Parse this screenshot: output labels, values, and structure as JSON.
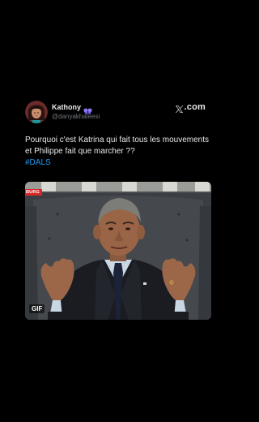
{
  "tweet": {
    "display_name": "Kathony",
    "badge_icon": "butterfly-icon",
    "handle": "@danyakhaleesi",
    "brand_text": ".com",
    "brand_icon": "x-logo-icon",
    "text_line": "Pourquoi c'est Katrina qui fait tous les mouvements et Philippe fait que marcher ??",
    "hashtag": "#DALS",
    "media": {
      "live_tag": "BURG",
      "gif_label": "GIF"
    }
  },
  "colors": {
    "background": "#000000",
    "text": "#e7e9ea",
    "secondary": "#71767b",
    "link": "#1d9bf0",
    "badge": "#8b7cf6"
  }
}
